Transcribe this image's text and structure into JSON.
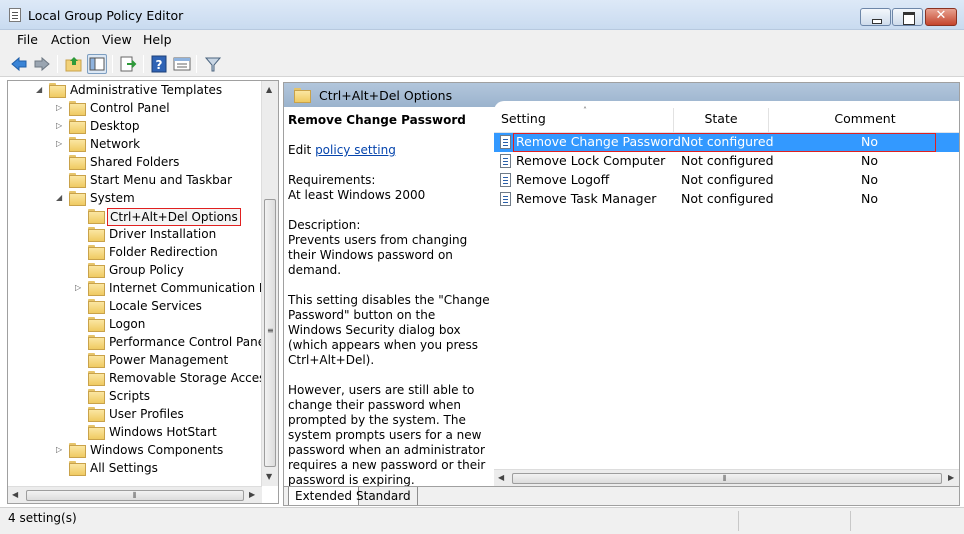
{
  "window": {
    "title": "Local Group Policy Editor",
    "close_glyph": "✕"
  },
  "menu": [
    {
      "label": "File"
    },
    {
      "label": "Action"
    },
    {
      "label": "View"
    },
    {
      "label": "Help"
    }
  ],
  "toolbar": {
    "buttons": [
      "back-icon",
      "forward-icon",
      "up-folder-icon",
      "show-hide-tree-icon",
      "export-list-icon",
      "help-icon",
      "properties-view-icon",
      "filter-icon"
    ]
  },
  "tree": {
    "items": [
      {
        "label": "Administrative Templates",
        "indent": 1,
        "arrow": "◢",
        "expanded": true
      },
      {
        "label": "Control Panel",
        "indent": 2,
        "arrow": "▷"
      },
      {
        "label": "Desktop",
        "indent": 2,
        "arrow": "▷"
      },
      {
        "label": "Network",
        "indent": 2,
        "arrow": "▷"
      },
      {
        "label": "Shared Folders",
        "indent": 2,
        "arrow": ""
      },
      {
        "label": "Start Menu and Taskbar",
        "indent": 2,
        "arrow": ""
      },
      {
        "label": "System",
        "indent": 2,
        "arrow": "◢",
        "expanded": true
      },
      {
        "label": "Ctrl+Alt+Del Options",
        "indent": 3,
        "arrow": "",
        "selected": true
      },
      {
        "label": "Driver Installation",
        "indent": 3,
        "arrow": ""
      },
      {
        "label": "Folder Redirection",
        "indent": 3,
        "arrow": ""
      },
      {
        "label": "Group Policy",
        "indent": 3,
        "arrow": ""
      },
      {
        "label": "Internet Communication Ma",
        "indent": 3,
        "arrow": "▷"
      },
      {
        "label": "Locale Services",
        "indent": 3,
        "arrow": ""
      },
      {
        "label": "Logon",
        "indent": 3,
        "arrow": ""
      },
      {
        "label": "Performance Control Panel",
        "indent": 3,
        "arrow": ""
      },
      {
        "label": "Power Management",
        "indent": 3,
        "arrow": ""
      },
      {
        "label": "Removable Storage Access",
        "indent": 3,
        "arrow": ""
      },
      {
        "label": "Scripts",
        "indent": 3,
        "arrow": ""
      },
      {
        "label": "User Profiles",
        "indent": 3,
        "arrow": ""
      },
      {
        "label": "Windows HotStart",
        "indent": 3,
        "arrow": ""
      },
      {
        "label": "Windows Components",
        "indent": 2,
        "arrow": "▷"
      },
      {
        "label": "All Settings",
        "indent": 2,
        "arrow": "",
        "icon": "all-settings-icon"
      }
    ]
  },
  "details": {
    "header_title": "Ctrl+Alt+Del Options",
    "setting_name": "Remove Change Password",
    "edit_prefix": "Edit ",
    "edit_link": "policy setting ",
    "requirements_label": "Requirements:",
    "requirements_value": "At least Windows 2000",
    "description_label": "Description:",
    "description_p1": "Prevents users from changing their Windows password on demand.",
    "description_p2": "This setting disables the \"Change Password\" button on the Windows Security dialog box (which appears when you press Ctrl+Alt+Del).",
    "description_p3": "However, users are still able to change their password when prompted by the system. The system prompts users for a new password when an administrator requires a new password or their password is expiring."
  },
  "list": {
    "columns": {
      "setting": "Setting",
      "state": "State",
      "comment": "Comment"
    },
    "sort_caret": "˄",
    "rows": [
      {
        "setting": "Remove Change Password",
        "state": "Not configured",
        "comment": "No",
        "selected": true
      },
      {
        "setting": "Remove Lock Computer",
        "state": "Not configured",
        "comment": "No"
      },
      {
        "setting": "Remove Logoff",
        "state": "Not configured",
        "comment": "No"
      },
      {
        "setting": "Remove Task Manager",
        "state": "Not configured",
        "comment": "No"
      }
    ]
  },
  "tabs": [
    {
      "label": "Extended",
      "active": true
    },
    {
      "label": "Standard",
      "active": false
    }
  ],
  "status": {
    "text": "4 setting(s)"
  },
  "colors": {
    "selection": "#3399ff",
    "highlight_border": "#e02020",
    "header": "#a7bdd6"
  }
}
